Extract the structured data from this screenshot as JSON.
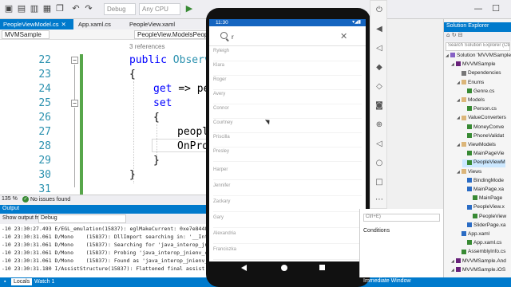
{
  "toolbar": {
    "config": "Debug",
    "platform": "Any CPU",
    "window_min": "—",
    "window_max": "☐"
  },
  "tabs": [
    {
      "label": "PeopleViewModel.cs",
      "close": "✕"
    },
    {
      "label": "App.xaml.cs",
      "close": ""
    },
    {
      "label": "PeopleView.xaml",
      "close": ""
    }
  ],
  "navbar": {
    "project": "MVMSample",
    "right_label": "PeopleView.ModelsPeopleViewMo"
  },
  "editor": {
    "references": "3 references",
    "lines": [
      {
        "num": "22",
        "kw": "public ",
        "rest": "Observ"
      },
      {
        "num": "23",
        "kw": "",
        "rest": "{"
      },
      {
        "num": "24",
        "kw": "get ",
        "rest": "=> pe"
      },
      {
        "num": "25",
        "kw": "set",
        "rest": ""
      },
      {
        "num": "26",
        "kw": "",
        "rest": "{"
      },
      {
        "num": "27",
        "kw": "",
        "rest": "people"
      },
      {
        "num": "28",
        "kw": "",
        "rest": "OnPro"
      },
      {
        "num": "29",
        "kw": "",
        "rest": "}"
      },
      {
        "num": "30",
        "kw": "",
        "rest": "}"
      },
      {
        "num": "31",
        "kw": "",
        "rest": ""
      }
    ]
  },
  "editor_status": {
    "zoom": "135 %",
    "issues": "No issues found"
  },
  "output": {
    "title": "Output",
    "show_from_label": "Show output from:",
    "show_from_value": "Debug",
    "lines": [
      "-10 23:30:27.493 E/EGL_emulation(15837): eglMakeCurrent: 0xe7e84480",
      "-10 23:30:31.061 D/Mono    (15837): DllImport searching in: '__Inter",
      "-10 23:30:31.061 D/Mono    (15837): Searching for 'java_interop_jnie",
      "-10 23:30:31.061 D/Mono    (15837): Probing 'java_interop_jnienv_cal",
      "-10 23:30:31.061 D/Mono    (15837): Found as 'java_interop_jnienv_ca",
      "-10 23:30:31.180 I/AssistStructure(15837): Flattened final assist da"
    ]
  },
  "bottom_tabs": {
    "locals": "Locals",
    "watch": "Watch 1",
    "immediate": "Immediate Window"
  },
  "phone": {
    "time": "11:30",
    "status_icons": "▾◢▮",
    "search_value": "r",
    "people": [
      "Ryleigh",
      "Klara",
      "Roger",
      "Avery",
      "Connor",
      "Courtney",
      "Priscilla",
      "Presley",
      "Harper",
      "Jennifer",
      "Zackary",
      "Gary",
      "Alexandria",
      "Franciszka"
    ]
  },
  "emulator": {
    "icons": [
      "power-icon",
      "volume-up-icon",
      "volume-down-icon",
      "rotate-left-icon",
      "rotate-right-icon",
      "camera-icon",
      "zoom-icon",
      "back-icon",
      "home-icon",
      "overview-icon",
      "more-icon"
    ]
  },
  "properties": {
    "search": "Ctrl+E)",
    "item": "Conditions"
  },
  "solution": {
    "title": "Solution Explorer",
    "search": "Search Solution Explorer (Ctr",
    "items": [
      {
        "label": "Solution 'MVVMSample'",
        "indent": 0,
        "icon": "sol"
      },
      {
        "label": "MVVMSample",
        "indent": 1,
        "icon": "proj"
      },
      {
        "label": "Dependencies",
        "indent": 2,
        "icon": "ref"
      },
      {
        "label": "Enums",
        "indent": 2,
        "icon": "folder"
      },
      {
        "label": "Genre.cs",
        "indent": 3,
        "icon": "cs"
      },
      {
        "label": "Models",
        "indent": 2,
        "icon": "folder"
      },
      {
        "label": "Person.cs",
        "indent": 3,
        "icon": "cs"
      },
      {
        "label": "ValueConverters",
        "indent": 2,
        "icon": "folder"
      },
      {
        "label": "MoneyConve",
        "indent": 3,
        "icon": "cs"
      },
      {
        "label": "PhoneValidat",
        "indent": 3,
        "icon": "cs"
      },
      {
        "label": "ViewModels",
        "indent": 2,
        "icon": "folder"
      },
      {
        "label": "MainPageVie",
        "indent": 3,
        "icon": "cs"
      },
      {
        "label": "PeopleViewM",
        "indent": 3,
        "icon": "cs"
      },
      {
        "label": "Views",
        "indent": 2,
        "icon": "folder"
      },
      {
        "label": "BindingMode",
        "indent": 3,
        "icon": "xaml"
      },
      {
        "label": "MainPage.xa",
        "indent": 3,
        "icon": "xaml"
      },
      {
        "label": "MainPage",
        "indent": 4,
        "icon": "cs"
      },
      {
        "label": "PeopleView.x",
        "indent": 3,
        "icon": "xaml"
      },
      {
        "label": "PeopleView",
        "indent": 4,
        "icon": "cs"
      },
      {
        "label": "SliderPage.xa",
        "indent": 3,
        "icon": "xaml"
      },
      {
        "label": "App.xaml",
        "indent": 2,
        "icon": "xaml"
      },
      {
        "label": "App.xaml.cs",
        "indent": 3,
        "icon": "cs"
      },
      {
        "label": "AssemblyInfo.cs",
        "indent": 2,
        "icon": "cs"
      },
      {
        "label": "MVVMSample.And",
        "indent": 1,
        "icon": "proj"
      },
      {
        "label": "MVVMSample.iOS",
        "indent": 1,
        "icon": "proj"
      }
    ]
  }
}
